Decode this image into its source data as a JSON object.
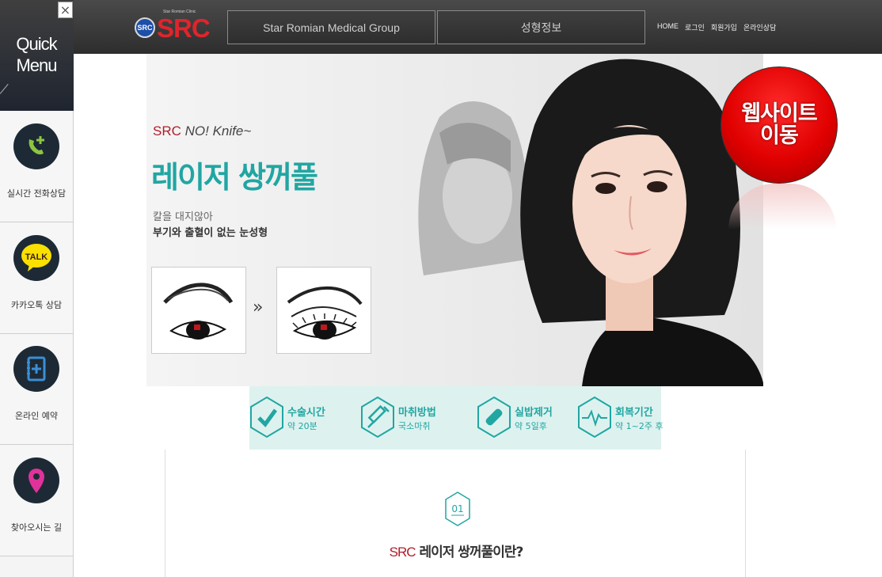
{
  "header": {
    "logo_text": "SRC",
    "logo_badge": "SRC",
    "logo_subtitle": "Star Romian Clinic",
    "nav": [
      "Star Romian Medical Group",
      "성형정보"
    ],
    "util_links": [
      "HOME",
      "로그인",
      "회원가입",
      "온라인상담"
    ]
  },
  "quick_menu": {
    "title_line1": "Quick",
    "title_line2": "Menu",
    "close_label": "×",
    "items": [
      {
        "label": "실시간 전화상담",
        "icon": "phone-plus-icon",
        "icon_color": "#8cc63f"
      },
      {
        "label": "카카오톡 상담",
        "icon": "kakaotalk-icon",
        "icon_color": "#f9e000",
        "icon_text": "TALK"
      },
      {
        "label": "온라인 예약",
        "icon": "calendar-plus-icon",
        "icon_color": "#3a8fd6"
      },
      {
        "label": "찾아오시는 길",
        "icon": "location-pin-icon",
        "icon_color": "#e0329a"
      }
    ]
  },
  "banner": {
    "small_brand": "SRC",
    "small_text": "NO! Knife~",
    "title": "레이저 쌍꺼풀",
    "sub1": "칼을 대지않아",
    "sub2": "부기와 출혈이 없는 눈성형",
    "arrow": "»"
  },
  "website_button": {
    "line1": "웹사이트",
    "line2": "이동",
    "color": "#e00000"
  },
  "info_strip": {
    "accent": "#21a6a2",
    "items": [
      {
        "title": "수술시간",
        "value": "약 20분",
        "icon": "check-icon"
      },
      {
        "title": "마취방법",
        "value": "국소마취",
        "icon": "syringe-icon"
      },
      {
        "title": "실밥제거",
        "value": "약 5일후",
        "icon": "bandage-icon"
      },
      {
        "title": "회복기간",
        "value": "약 1~2주 후",
        "icon": "pulse-icon"
      }
    ]
  },
  "section": {
    "number": "01",
    "title_brand": "SRC",
    "title_text": " 레이저 쌍꺼풀이란?"
  }
}
